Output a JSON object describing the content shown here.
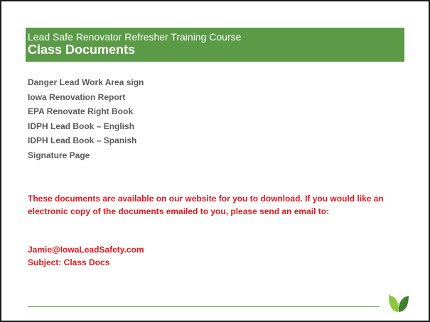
{
  "header": {
    "course": "Lead Safe Renovator Refresher Training Course",
    "title": "Class Documents"
  },
  "documents": [
    "Danger Lead Work Area sign",
    "Iowa Renovation Report",
    "EPA Renovate Right Book",
    "IDPH Lead Book – English",
    "IDPH Lead Book – Spanish",
    "Signature Page"
  ],
  "notice": "These documents are available on our website for you to download.  If you would like an electronic copy of the documents emailed to you, please send an email to:",
  "contact": {
    "email": "Jamie@IowaLeadSafety.com",
    "subject": "Subject:  Class Docs"
  },
  "colors": {
    "accent_green": "#5b9b47",
    "leaf_light": "#8cc83c",
    "leaf_dark": "#3d7f2e",
    "notice_red": "#e8141b",
    "body_gray": "#595959"
  },
  "icons": {
    "logo": "leaf-logo-icon"
  }
}
